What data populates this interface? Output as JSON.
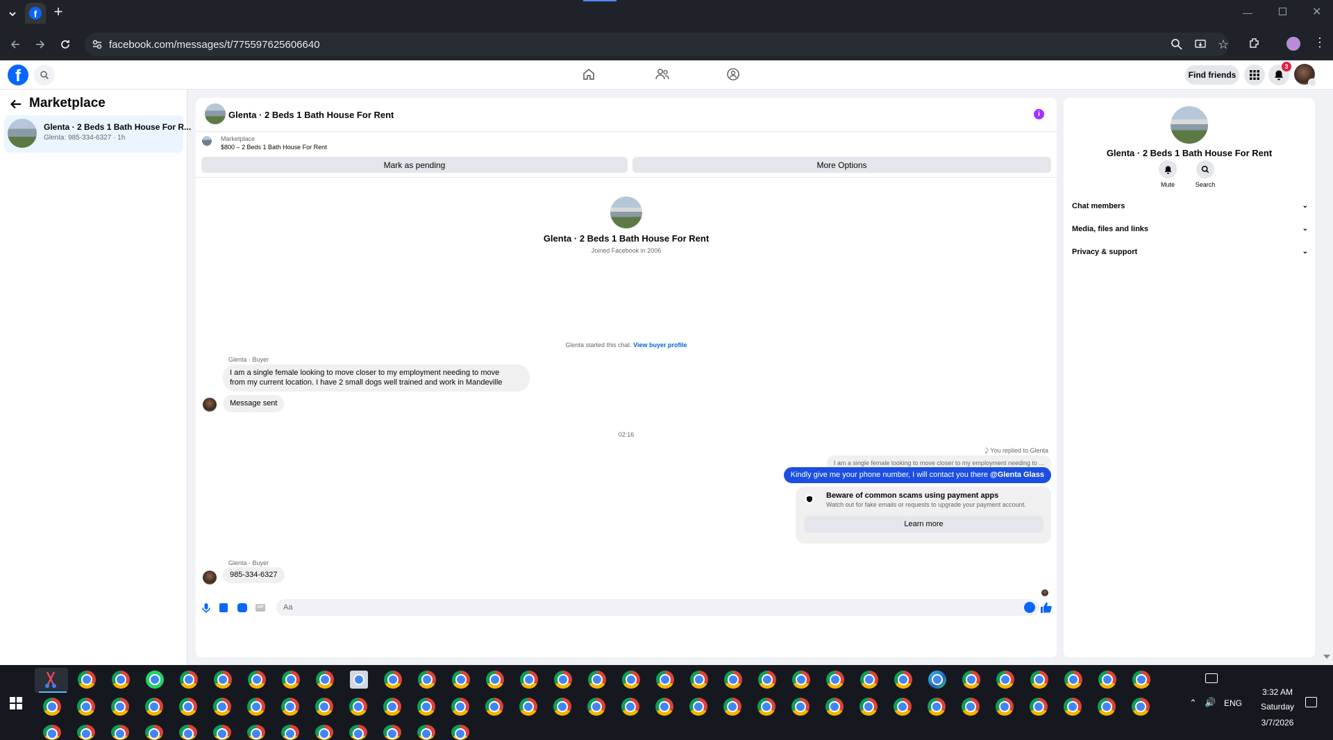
{
  "browser": {
    "url": "facebook.com/messages/t/775597625606640",
    "new_tab": "+"
  },
  "header": {
    "find_friends": "Find friends",
    "notif_count": "3"
  },
  "sidebar": {
    "title": "Marketplace",
    "conversation": {
      "title": "Glenta · 2 Beds 1 Bath House For R...",
      "subtitle": "Glenta: 985-334-6327 · 1h"
    }
  },
  "chat": {
    "title": "Glenta · 2 Beds 1 Bath House For Rent",
    "listing_label": "Marketplace",
    "listing_detail": "$800 – 2 Beds 1 Bath House For Rent",
    "mark_pending": "Mark as pending",
    "more_options": "More Options",
    "profile_name": "Glenta · 2 Beds 1 Bath House For Rent",
    "joined": "Joined Facebook in 2006",
    "started_text": "Glenta started this chat.",
    "view_buyer": "View buyer profile",
    "sender1": "Glenta · Buyer",
    "msg1_line1": "I am a single female looking to move closer to my employment needing to move",
    "msg1_line2": "from my current location. I have 2 small dogs well trained and work in Mandeville",
    "msg_sent": "Message sent",
    "time": "02:16",
    "replied": "You replied to Glenta",
    "quote": "I am a single female looking to move closer to my employment needing to ...",
    "reply_text": "Kindly give me your phone number, I will contact you there ",
    "reply_mention": "@Glenta Glass",
    "scam_title": "Beware of common scams using payment apps",
    "scam_body": "Watch out for fake emails or requests to upgrade your payment account.",
    "learn_more": "Learn more",
    "sender2": "Glenta · Buyer",
    "msg2": "985-334-6327",
    "composer_placeholder": "Aa"
  },
  "details": {
    "name": "Glenta · 2 Beds 1 Bath House For Rent",
    "mute": "Mute",
    "search": "Search",
    "sections": [
      "Chat members",
      "Media, files and links",
      "Privacy & support"
    ]
  },
  "taskbar": {
    "time": "3:32 AM",
    "day": "Saturday",
    "date": "3/7/2026",
    "lang": "ENG"
  },
  "colors": {
    "fb_blue": "#0866ff",
    "bubble_blue": "#1c4fe0",
    "accent_purple": "#a033ff"
  }
}
